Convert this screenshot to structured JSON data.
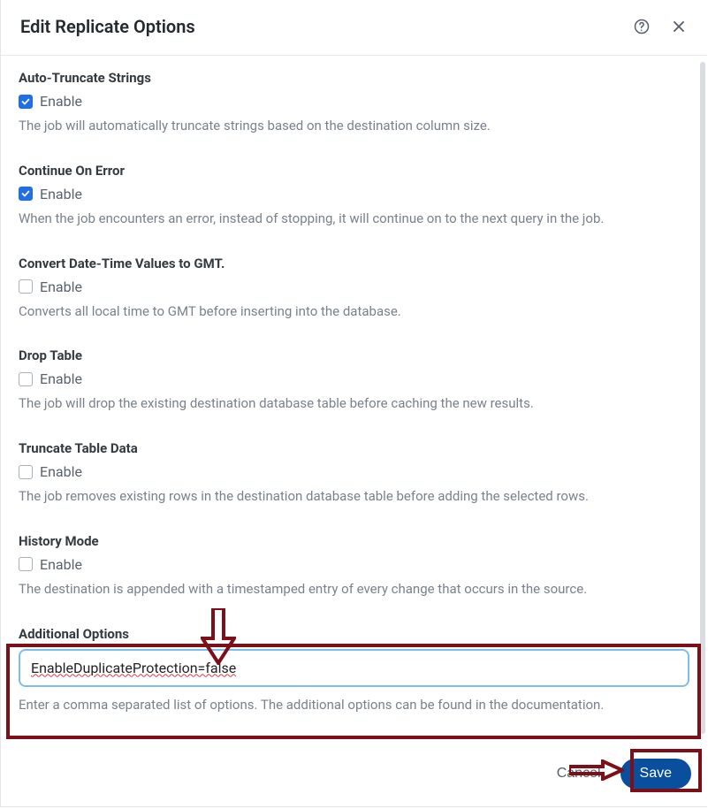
{
  "header": {
    "title": "Edit Replicate Options"
  },
  "enable_label": "Enable",
  "options": [
    {
      "key": "auto_truncate",
      "title": "Auto-Truncate Strings",
      "checked": true,
      "description": "The job will automatically truncate strings based on the destination column size."
    },
    {
      "key": "continue_on_error",
      "title": "Continue On Error",
      "checked": true,
      "description": "When the job encounters an error, instead of stopping, it will continue on to the next query in the job."
    },
    {
      "key": "convert_gmt",
      "title": "Convert Date-Time Values to GMT.",
      "checked": false,
      "description": "Converts all local time to GMT before inserting into the database."
    },
    {
      "key": "drop_table",
      "title": "Drop Table",
      "checked": false,
      "description": "The job will drop the existing destination database table before caching the new results."
    },
    {
      "key": "truncate_table",
      "title": "Truncate Table Data",
      "checked": false,
      "description": "The job removes existing rows in the destination database table before adding the selected rows."
    },
    {
      "key": "history_mode",
      "title": "History Mode",
      "checked": false,
      "description": "The destination is appended with a timestamped entry of every change that occurs in the source."
    }
  ],
  "additional": {
    "title": "Additional Options",
    "value": "EnableDuplicateProtection=false",
    "hint": "Enter a comma separated list of options. The additional options can be found in the documentation."
  },
  "footer": {
    "cancel": "Cancel",
    "save": "Save"
  }
}
